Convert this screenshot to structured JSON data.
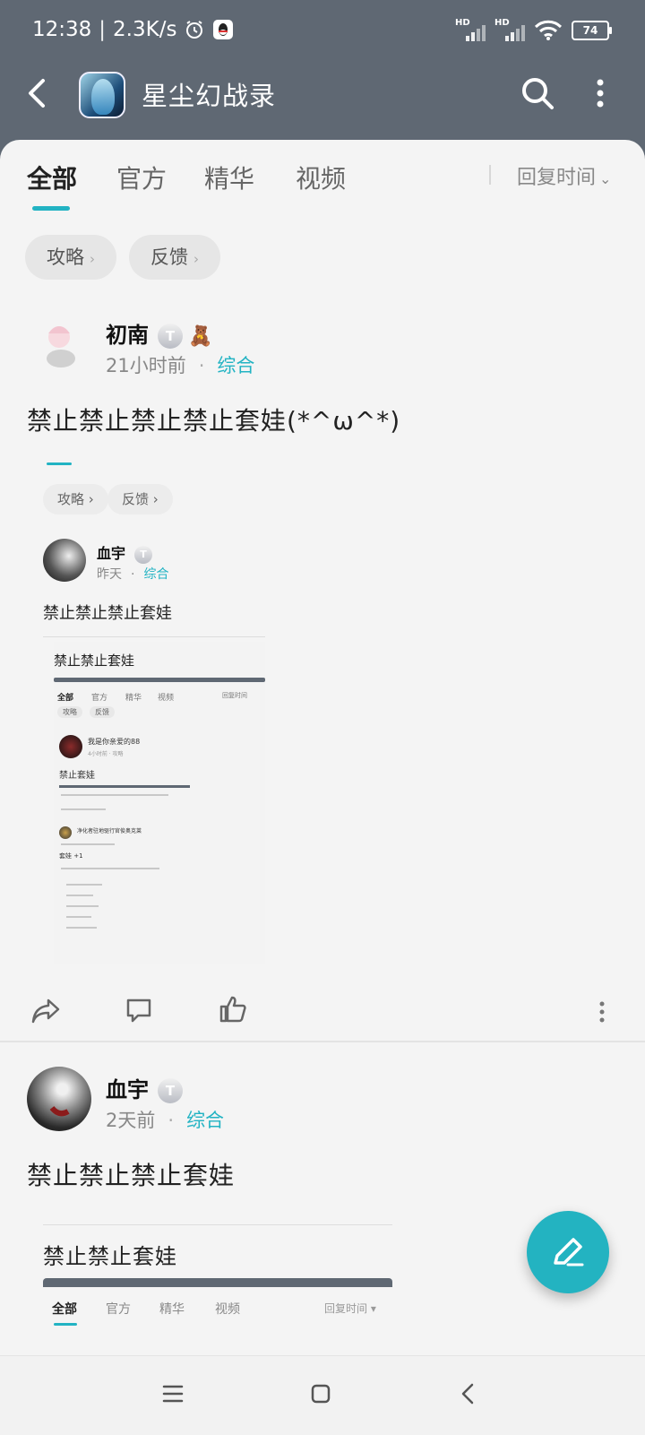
{
  "status": {
    "time": "12:38",
    "speed": "2.3K/s",
    "battery": "74"
  },
  "app": {
    "title": "星尘幻战录"
  },
  "tabs": [
    "全部",
    "官方",
    "精华",
    "视频"
  ],
  "sort_label": "回复时间",
  "chips": [
    "攻略",
    "反馈"
  ],
  "posts": [
    {
      "author": "初南",
      "time": "21小时前",
      "category": "综合",
      "title": "禁止禁止禁止禁止套娃(*^ω^*)",
      "embedded": {
        "chips": [
          "攻略",
          "反馈"
        ],
        "author": "血宇",
        "time": "昨天",
        "category": "综合",
        "title": "禁止禁止禁止套娃",
        "nested_title": "禁止禁止套娃",
        "nested_tabs": [
          "全部",
          "官方",
          "精华",
          "视频"
        ],
        "nested_sort": "回复时间",
        "nested_chips": [
          "攻略",
          "反馈"
        ],
        "nested_author": "我是你亲爱的88",
        "nested_meta": "4小时前 · 攻略",
        "nested_post_title": "禁止套娃",
        "deep_author": "净化者驻地驱行官俊奥克莱",
        "deep_title": "套娃 +1"
      }
    },
    {
      "author": "血宇",
      "time": "2天前",
      "category": "综合",
      "title": "禁止禁止禁止套娃",
      "embedded": {
        "nested_title": "禁止禁止套娃",
        "tabs": [
          "全部",
          "官方",
          "精华",
          "视频"
        ],
        "sort": "回复时间"
      }
    }
  ],
  "colors": {
    "accent": "#22b3c3",
    "header": "#5f6873"
  }
}
